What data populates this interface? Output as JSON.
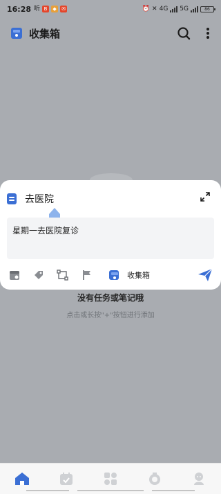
{
  "status_bar": {
    "time": "16:28",
    "carrier_text": "听",
    "network_label": "4G",
    "network_label_2": "5G",
    "battery": "86"
  },
  "header": {
    "title": "收集箱",
    "search_icon": "search-icon",
    "more_icon": "more-vertical-icon"
  },
  "empty_state": {
    "title": "没有任务或笔记哦",
    "hint": "点击或长按\"+\"按钮进行添加"
  },
  "quick_add": {
    "task_title": "去医院",
    "description": "星期一去医院复诊",
    "project_label": "收集箱",
    "toolbar_icons": [
      "date-icon",
      "tag-icon",
      "subtask-icon",
      "priority-flag-icon",
      "inbox-icon",
      "send-icon"
    ]
  },
  "bottom_nav": {
    "items": [
      "home-icon",
      "calendar-icon",
      "apps-grid-icon",
      "habit-icon",
      "profile-icon"
    ],
    "active": 0
  },
  "colors": {
    "accent": "#3b6fd4",
    "overlay": "#a9acb1",
    "card": "#ffffff"
  }
}
